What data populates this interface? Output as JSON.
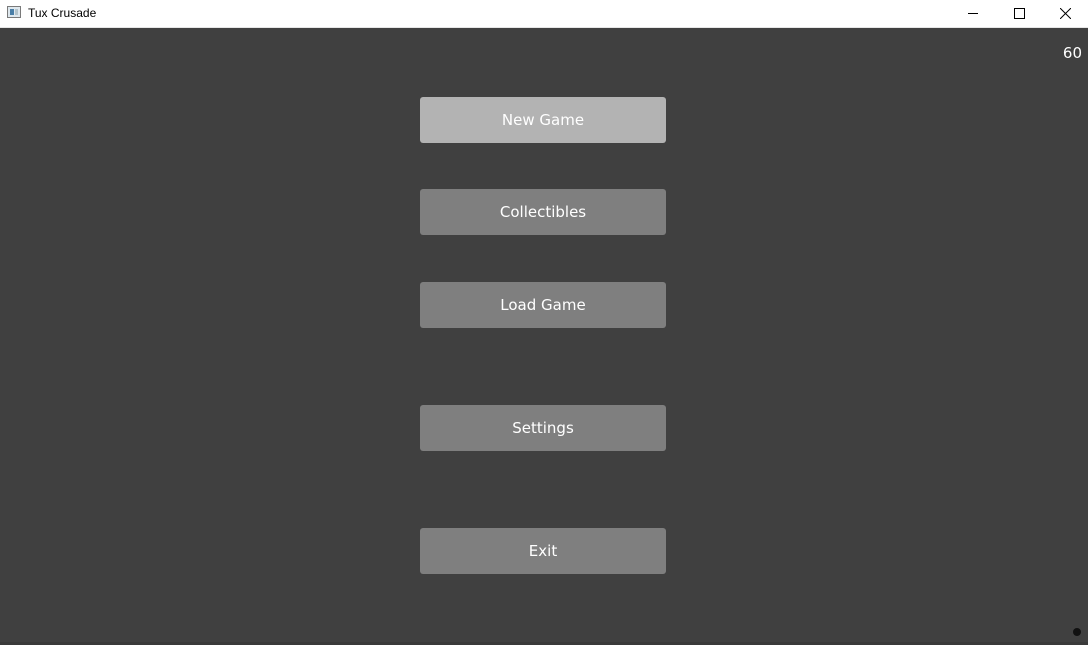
{
  "window": {
    "title": "Tux Crusade",
    "icon": "app-window-icon",
    "controls": {
      "minimize_icon": "minimize-icon",
      "maximize_icon": "maximize-icon",
      "close_icon": "close-icon"
    }
  },
  "hud": {
    "fps": "60"
  },
  "menu": {
    "buttons": [
      {
        "label": "New Game",
        "state": "hovered"
      },
      {
        "label": "Collectibles",
        "state": "normal"
      },
      {
        "label": "Load Game",
        "state": "normal"
      },
      {
        "label": "Settings",
        "state": "normal"
      },
      {
        "label": "Exit",
        "state": "normal"
      }
    ]
  },
  "colors": {
    "background": "#404040",
    "button": "#7f7f7f",
    "button_hovered": "#b3b3b3",
    "button_text": "#ffffff",
    "titlebar": "#ffffff"
  }
}
